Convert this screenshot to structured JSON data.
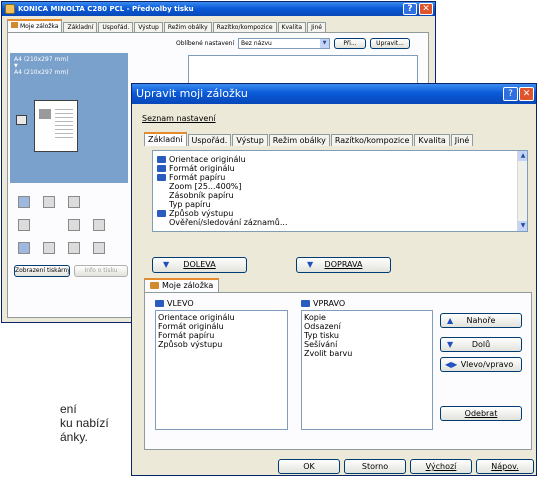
{
  "back_window": {
    "title": "KONICA MINOLTA C280 PCL - Předvolby tisku",
    "tabs": [
      "Moje záložka",
      "Základní",
      "Uspořád.",
      "Výstup",
      "Režim obálky",
      "Razítko/kompozice",
      "Kvalita",
      "Jiné"
    ],
    "favorites_label": "Oblíbené nastavení",
    "favorites_value": "Bez názvu",
    "add_button": "Při...",
    "edit_button": "Upravit...",
    "paper_line1": "A4 (210x297 mm)",
    "paper_arrow": "▼",
    "paper_line2": "A4 (210x297 mm)",
    "show_settings_button": "Zobrazení tiskárny",
    "info_button": "Info o tisku"
  },
  "front_window": {
    "title": "Upravit moji záložku",
    "list_settings_label": "Seznam nastavení",
    "tabs": [
      "Základní",
      "Uspořád.",
      "Výstup",
      "Režim obálky",
      "Razítko/kompozice",
      "Kvalita",
      "Jiné"
    ],
    "settings_items": [
      {
        "text": "Orientace originálu",
        "icon": true
      },
      {
        "text": "Formát originálu",
        "icon": true
      },
      {
        "text": "Formát papíru",
        "icon": true
      },
      {
        "text": "Zoom [25...400%]",
        "icon": false
      },
      {
        "text": "Zásobník papíru",
        "icon": false
      },
      {
        "text": "Typ papíru",
        "icon": false
      },
      {
        "text": "Způsob výstupu",
        "icon": true
      },
      {
        "text": "Ověření/sledování záznamů...",
        "icon": false
      }
    ],
    "left_button": "DOLEVA",
    "right_button": "DOPRAVA",
    "my_tab_label": "Moje záložka",
    "left_header": "VLEVO",
    "right_header": "VPRAVO",
    "left_items": [
      "Orientace originálu",
      "Formát originálu",
      "Formát papíru",
      "Způsob výstupu"
    ],
    "right_items": [
      "Kopie",
      "Odsazení",
      "Typ tisku",
      "Sešívání",
      "Zvolit barvu"
    ],
    "up_button": "Nahoře",
    "down_button": "Dolů",
    "swap_button": "Vlevo/vpravo",
    "remove_button": "Odebrat",
    "ok_button": "OK",
    "cancel_button": "Storno",
    "default_button": "Výchozí",
    "help_button": "Nápov."
  },
  "caption": {
    "lines": [
      "ení",
      "ku nabízí",
      "ánky."
    ]
  },
  "colors": {
    "titlebar": "#0a5ad8",
    "dialog_bg": "#ece9d8",
    "active_tab_accent": "#e68b2c",
    "close_button": "#e0542c"
  }
}
